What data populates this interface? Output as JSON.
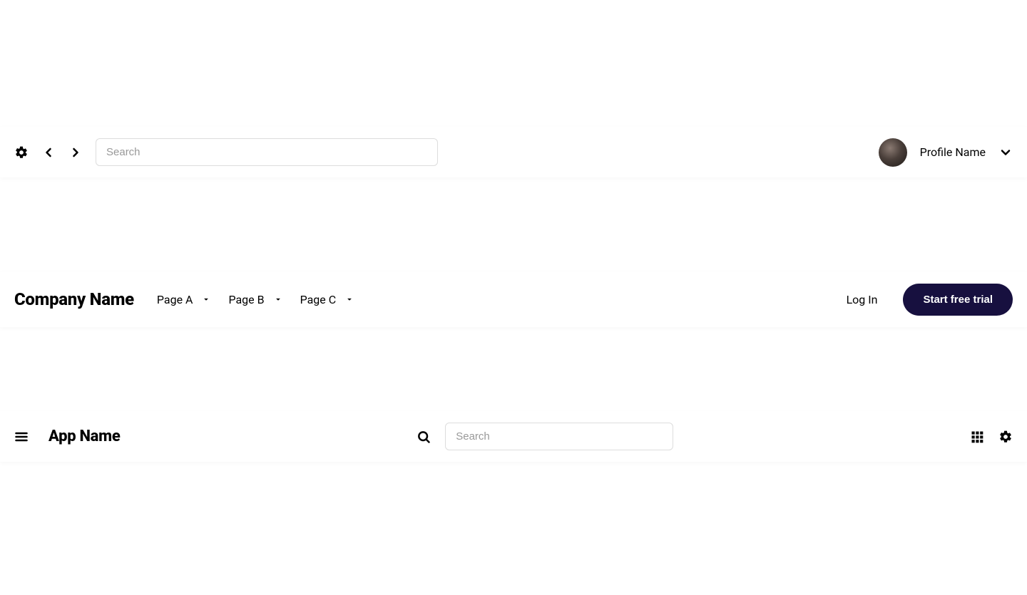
{
  "nav1": {
    "search_placeholder": "Search",
    "profile_name": "Profile Name"
  },
  "nav2": {
    "company": "Company Name",
    "pages": [
      "Page A",
      "Page B",
      "Page C"
    ],
    "login": "Log In",
    "trial": "Start free trial"
  },
  "nav3": {
    "app": "App Name",
    "search_placeholder": "Search"
  }
}
